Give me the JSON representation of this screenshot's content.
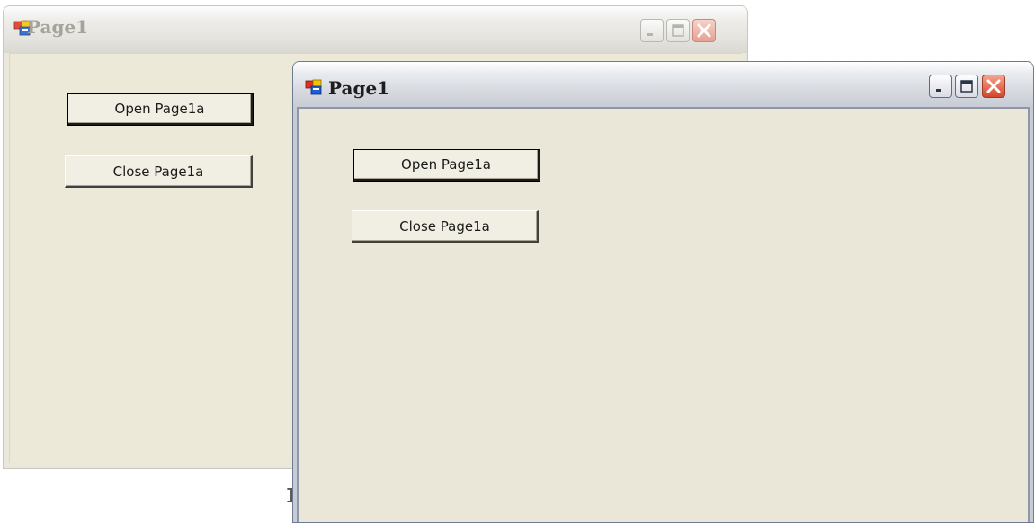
{
  "windows": [
    {
      "id": "back",
      "state": "inactive",
      "title": "Page1",
      "buttons": {
        "open": "Open Page1a",
        "close": "Close Page1a"
      },
      "caption_buttons": [
        "minimize-icon",
        "maximize-icon",
        "close-icon"
      ]
    },
    {
      "id": "front",
      "state": "active",
      "title": "Page1",
      "buttons": {
        "open": "Open Page1a",
        "close": "Close Page1a"
      },
      "caption_buttons": [
        "minimize-icon",
        "maximize-icon",
        "close-icon"
      ]
    }
  ],
  "colors": {
    "client_background": "#ece9d8",
    "active_close_button": "#d5462a",
    "inactive_title_text": "#a7a39a"
  },
  "background_fragment": "I"
}
